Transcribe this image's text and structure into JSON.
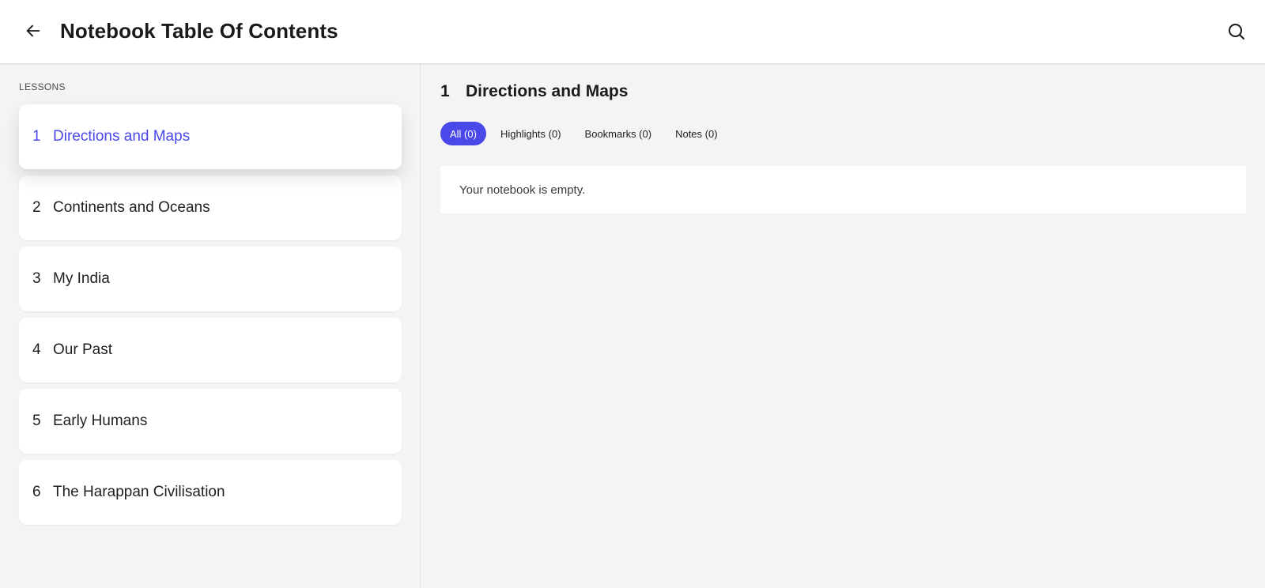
{
  "header": {
    "title": "Notebook Table Of Contents"
  },
  "sidebar": {
    "heading": "LESSONS",
    "items": [
      {
        "num": "1",
        "label": "Directions and Maps"
      },
      {
        "num": "2",
        "label": "Continents and Oceans"
      },
      {
        "num": "3",
        "label": "My India"
      },
      {
        "num": "4",
        "label": "Our Past"
      },
      {
        "num": "5",
        "label": "Early Humans"
      },
      {
        "num": "6",
        "label": "The Harappan Civilisation"
      }
    ],
    "active_index": 0
  },
  "main": {
    "lesson_num": "1",
    "lesson_title": "Directions and Maps",
    "tabs": [
      {
        "label": "All (0)"
      },
      {
        "label": "Highlights (0)"
      },
      {
        "label": "Bookmarks (0)"
      },
      {
        "label": "Notes (0)"
      }
    ],
    "active_tab": 0,
    "empty_message": "Your notebook is empty."
  },
  "colors": {
    "accent": "#4a48e8",
    "background": "#f4f4f4",
    "card": "#ffffff"
  },
  "icons": {
    "back": "arrow-left-icon",
    "search": "search-icon"
  }
}
